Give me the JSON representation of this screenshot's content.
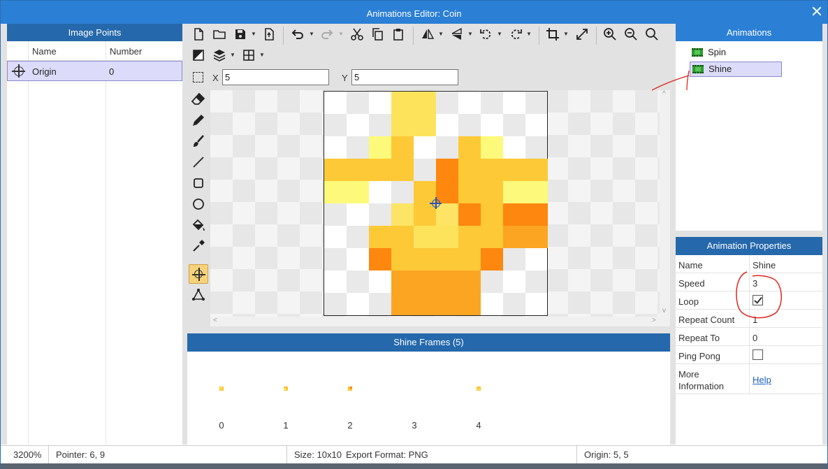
{
  "window": {
    "title": "Animations Editor: Coin"
  },
  "image_points": {
    "header": "Image Points",
    "columns": [
      "Name",
      "Number"
    ],
    "rows": [
      {
        "name": "Origin",
        "number": "0"
      }
    ]
  },
  "toolbar": {
    "x_label": "X",
    "x_value": "5",
    "y_label": "Y",
    "y_value": "5"
  },
  "sprite": {
    "cols": 10,
    "rows": 10,
    "palette": {
      "a": "#fde35c",
      "b": "#fdf97a",
      "c": "#fdc937",
      "d": "#fd870f",
      "e": "#fde465",
      "f": "#fba523"
    },
    "pixels": [
      "...aa.....",
      "...aa.....",
      "..bc..cb..",
      "cccc.dcccc",
      "bb..cdccbb",
      "...ecedcdd",
      "..ccaaccff",
      "..dccccd..",
      "...ffff...",
      "...ffff..."
    ]
  },
  "frames": {
    "header": "Shine Frames (5)",
    "items": [
      "0",
      "1",
      "2",
      "3",
      "4"
    ]
  },
  "animations": {
    "header": "Animations",
    "items": [
      {
        "label": "Spin"
      },
      {
        "label": "Shine"
      }
    ]
  },
  "properties": {
    "header": "Animation Properties",
    "rows": [
      {
        "label": "Name",
        "value": "Shine"
      },
      {
        "label": "Speed",
        "value": "3"
      },
      {
        "label": "Loop",
        "value": ""
      },
      {
        "label": "Repeat Count",
        "value": "1"
      },
      {
        "label": "Repeat To",
        "value": "0"
      },
      {
        "label": "Ping Pong",
        "value": ""
      },
      {
        "label": "More Information",
        "value": "Help"
      }
    ],
    "loop_checked": true,
    "ping_pong_checked": false
  },
  "status": {
    "zoom": "3200%",
    "pointer": "Pointer: 6, 9",
    "size": "Size: 10x10",
    "export": "Export Format: PNG",
    "origin": "Origin: 5, 5"
  }
}
